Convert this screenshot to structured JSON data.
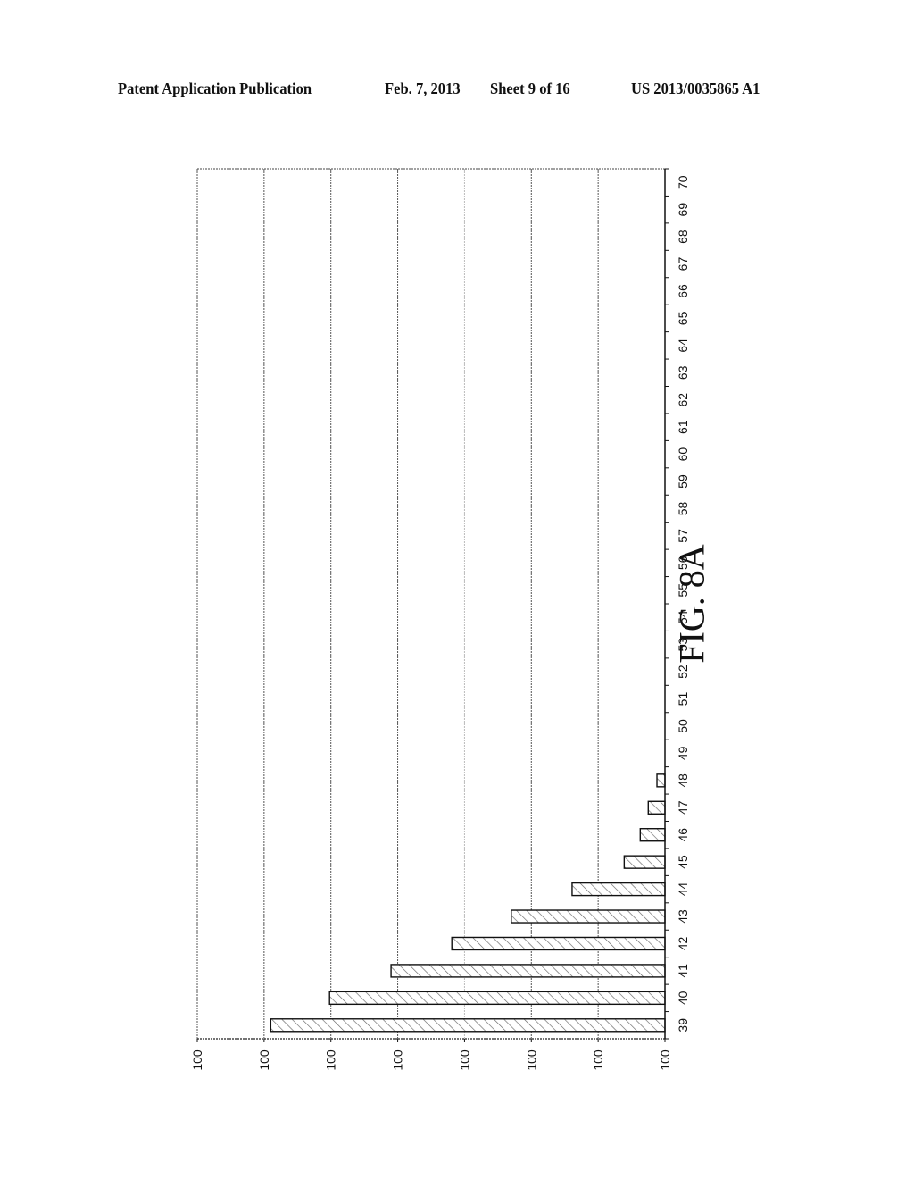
{
  "header": {
    "publication": "Patent Application Publication",
    "date": "Feb. 7, 2013",
    "sheet": "Sheet 9 of 16",
    "number": "US 2013/0035865 A1"
  },
  "figure": {
    "label": "FIG. 8A"
  },
  "chart_data": {
    "type": "bar",
    "orientation": "horizontal (page rotated 90°)",
    "title": "",
    "xlabel": "",
    "ylabel": "",
    "categories": [
      "39",
      "40",
      "41",
      "42",
      "43",
      "44",
      "45",
      "46",
      "47",
      "48",
      "49",
      "50",
      "51",
      "52",
      "53",
      "54",
      "55",
      "56",
      "57",
      "58",
      "59",
      "60",
      "61",
      "62",
      "63",
      "64",
      "65",
      "66",
      "67",
      "68",
      "69",
      "70"
    ],
    "values": [
      5.9,
      5.02,
      4.1,
      3.19,
      2.3,
      1.39,
      0.61,
      0.37,
      0.25,
      0.12,
      0,
      0,
      0,
      0,
      0,
      0,
      0,
      0,
      0,
      0,
      0,
      0,
      0,
      0,
      0,
      0,
      0,
      0,
      0,
      0,
      0,
      0
    ],
    "value_units": "gridline intervals (tick labels as printed all read 100)",
    "value_ticks": [
      0,
      1,
      2,
      3,
      4,
      5,
      6,
      7
    ],
    "value_tick_labels": [
      "100",
      "100",
      "100",
      "100",
      "100",
      "100",
      "100",
      "100"
    ],
    "ylim": [
      0,
      7
    ],
    "grid": true,
    "bar_fill": "diagonal-hatch",
    "legend": "none"
  }
}
